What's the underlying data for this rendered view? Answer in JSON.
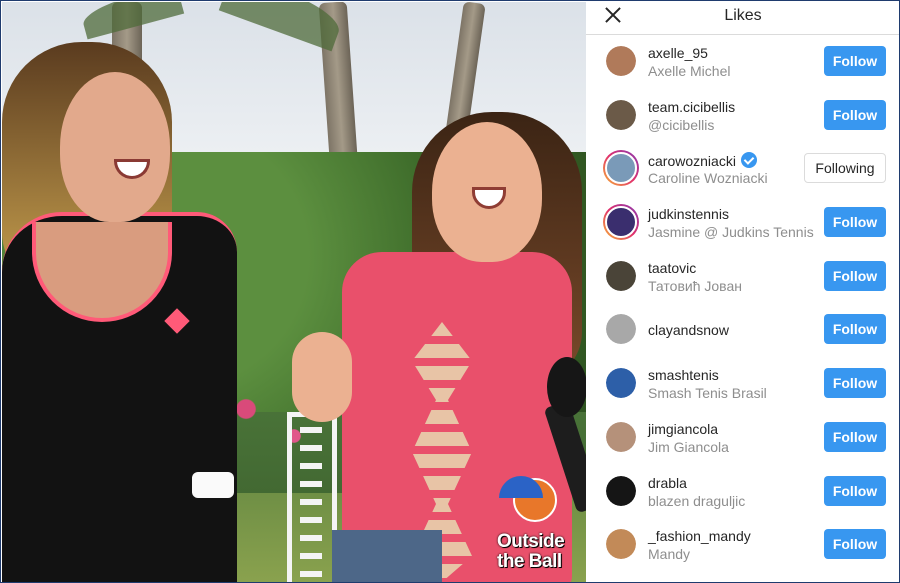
{
  "panel": {
    "title": "Likes",
    "users": [
      {
        "username": "axelle_95",
        "fullname": "Axelle Michel",
        "button": "Follow",
        "following": false,
        "verified": false,
        "story": false,
        "avatar_color": "#b07a5a"
      },
      {
        "username": "team.cicibellis",
        "fullname": "@cicibellis",
        "button": "Follow",
        "following": false,
        "verified": false,
        "story": false,
        "avatar_color": "#6b5a48"
      },
      {
        "username": "carowozniacki",
        "fullname": "Caroline Wozniacki",
        "button": "Following",
        "following": true,
        "verified": true,
        "story": true,
        "avatar_color": "#7a9ab8"
      },
      {
        "username": "judkinstennis",
        "fullname": "Jasmine @ Judkins Tennis",
        "button": "Follow",
        "following": false,
        "verified": false,
        "story": true,
        "avatar_color": "#3a2e6e"
      },
      {
        "username": "taatovic",
        "fullname": "Татовић Јован",
        "button": "Follow",
        "following": false,
        "verified": false,
        "story": false,
        "avatar_color": "#4a4438"
      },
      {
        "username": "clayandsnow",
        "fullname": "",
        "button": "Follow",
        "following": false,
        "verified": false,
        "story": false,
        "avatar_color": "#a8a8a8"
      },
      {
        "username": "smashtenis",
        "fullname": "Smash Tenis Brasil",
        "button": "Follow",
        "following": false,
        "verified": false,
        "story": false,
        "avatar_color": "#2d5fa8"
      },
      {
        "username": "jimgiancola",
        "fullname": "Jim Giancola",
        "button": "Follow",
        "following": false,
        "verified": false,
        "story": false,
        "avatar_color": "#b5917a"
      },
      {
        "username": "drabla",
        "fullname": "blazen draguljic",
        "button": "Follow",
        "following": false,
        "verified": false,
        "story": false,
        "avatar_color": "#151515"
      },
      {
        "username": "_fashion_mandy",
        "fullname": "Mandy",
        "button": "Follow",
        "following": false,
        "verified": false,
        "story": false,
        "avatar_color": "#c28a58"
      }
    ]
  },
  "watermark": {
    "line1": "Outside",
    "line2": "the Ball"
  },
  "colors": {
    "follow_button": "#3897f0",
    "verified": "#3897f0",
    "secondary_text": "#8e8e8e"
  }
}
